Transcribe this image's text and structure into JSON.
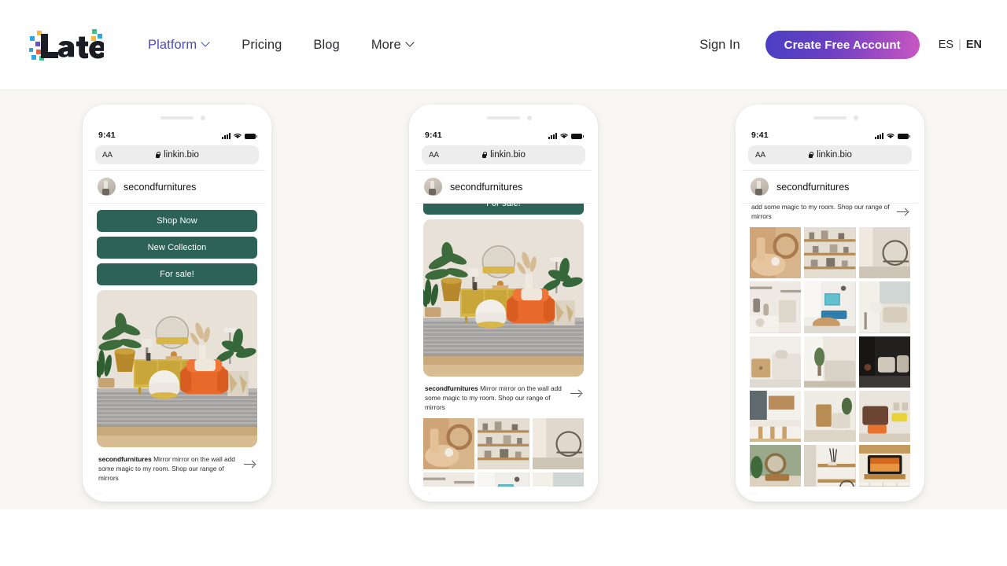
{
  "nav": {
    "logo_alt": "Later",
    "links": [
      {
        "label": "Platform",
        "has_chevron": true,
        "active": true
      },
      {
        "label": "Pricing",
        "has_chevron": false,
        "active": false
      },
      {
        "label": "Blog",
        "has_chevron": false,
        "active": false
      },
      {
        "label": "More",
        "has_chevron": true,
        "active": false
      }
    ],
    "sign_in": "Sign In",
    "cta": "Create Free Account",
    "lang_es": "ES",
    "lang_sep": "|",
    "lang_en": "EN",
    "cta_gradient_start": "#4b3fc4",
    "cta_gradient_end": "#c956c2",
    "active_link_color": "#4c4bb8"
  },
  "hero": {
    "background_color": "#f8f7f3"
  },
  "phone_common": {
    "status_time": "9:41",
    "url_aa": "AA",
    "url_text": "linkin.bio",
    "profile_name": "secondfurnitures",
    "link_button_color": "#2d6257",
    "caption_author": "secondfurnitures",
    "caption_body": " Mirror mirror on the wall add some magic to my room. Shop our range of mirrors",
    "caption_partial": "add some magic to my room. Shop our range of mirrors"
  },
  "phones": [
    {
      "id": "phone-1",
      "scroll_state": "top",
      "buttons": [
        "Shop Now",
        "New Collection",
        "For sale!"
      ],
      "shows_hero_photo": true,
      "shows_caption": true,
      "grid_rows_visible": 1
    },
    {
      "id": "phone-2",
      "scroll_state": "mid",
      "buttons": [
        "For sale!"
      ],
      "shows_hero_photo": true,
      "shows_caption": true,
      "grid_rows_visible": 2
    },
    {
      "id": "phone-3",
      "scroll_state": "bottom",
      "buttons": [],
      "shows_hero_photo": false,
      "shows_caption": true,
      "grid_rows_visible": 5
    }
  ]
}
